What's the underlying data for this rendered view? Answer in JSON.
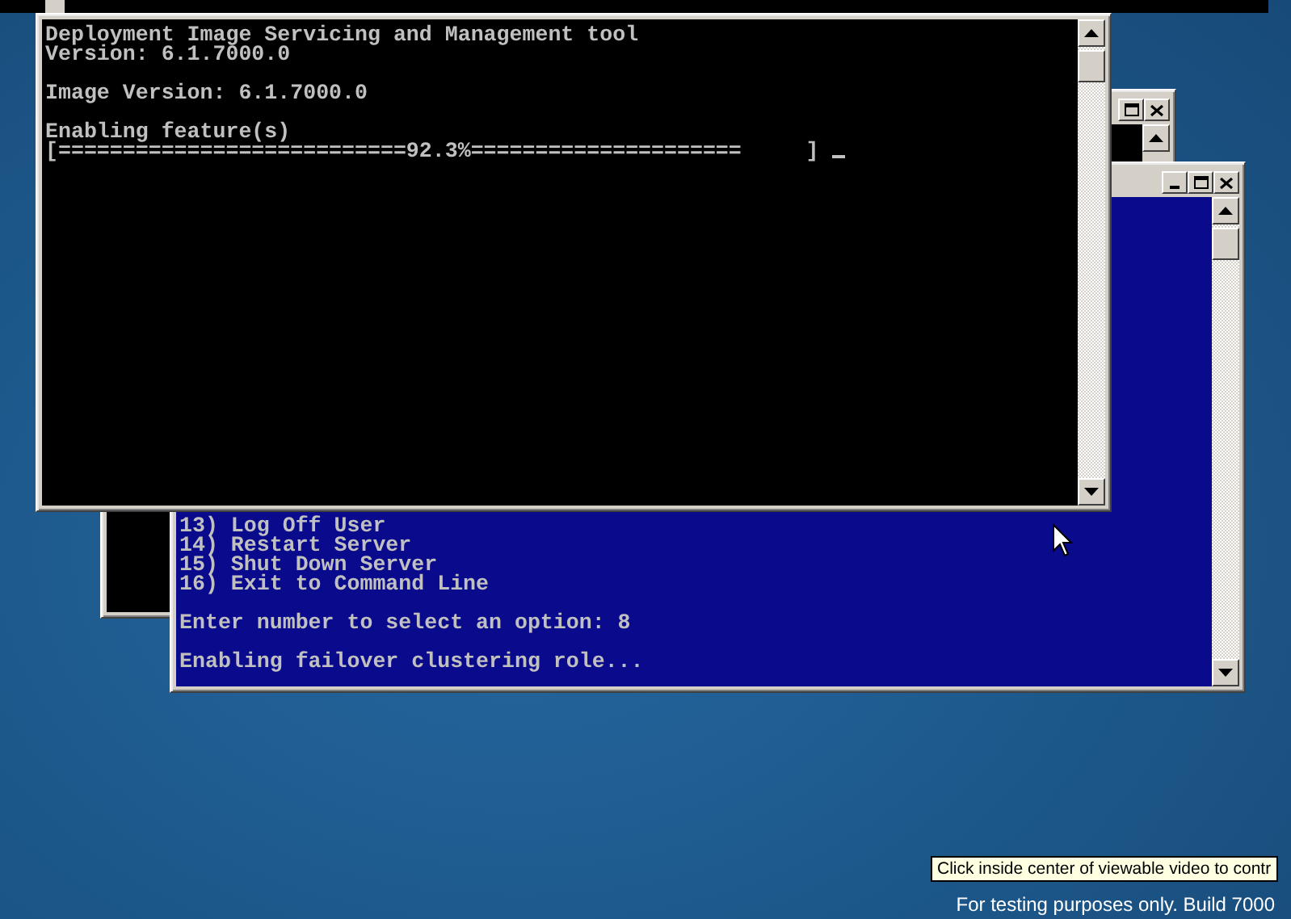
{
  "menu_window": {
    "blocks": [
      [
        "13) Log Off User",
        "14) Restart Server",
        "15) Shut Down Server",
        "16) Exit to Command Line"
      ],
      [
        "Enter number to select an option: 8"
      ],
      [
        "Enabling failover clustering role..."
      ]
    ]
  },
  "dism_window": {
    "blocks": [
      [
        "Deployment Image Servicing and Management tool",
        "Version: 6.1.7000.0"
      ],
      [
        "Image Version: 6.1.7000.0"
      ],
      [
        "Enabling feature(s)",
        "[===========================92.3%=====================     ]"
      ]
    ]
  },
  "tooltip": {
    "text": "Click inside center of viewable video to contr"
  },
  "desktop": {
    "build_note": "For testing purposes only. Build 7000"
  }
}
